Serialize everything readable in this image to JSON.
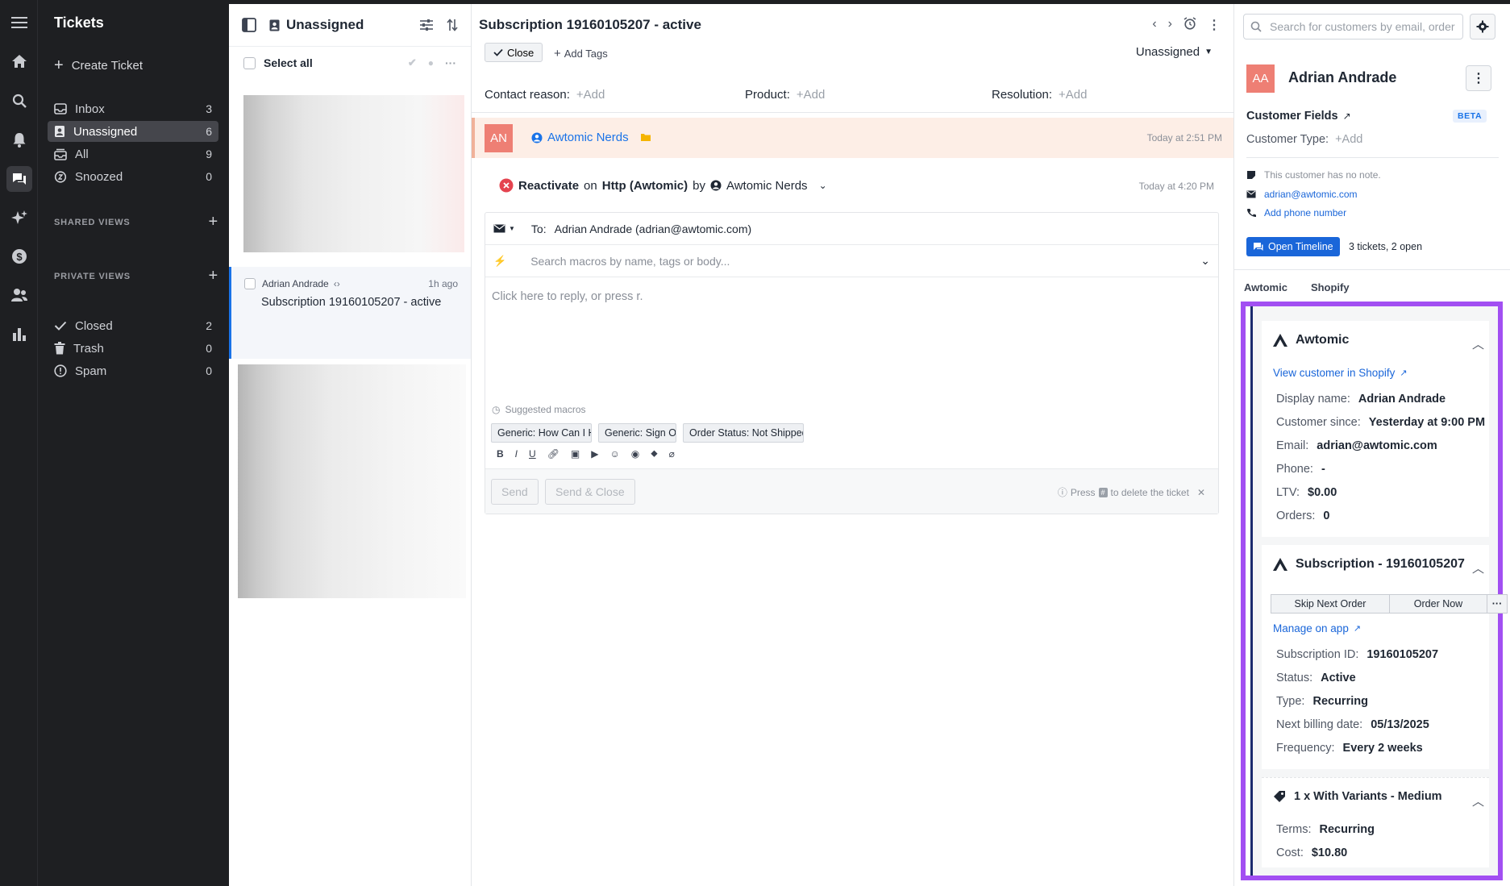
{
  "nav": {
    "title": "Tickets",
    "create": "Create Ticket",
    "items": [
      {
        "label": "Inbox",
        "count": "3"
      },
      {
        "label": "Unassigned",
        "count": "6"
      },
      {
        "label": "All",
        "count": "9"
      },
      {
        "label": "Snoozed",
        "count": "0"
      }
    ],
    "shared_views": "SHARED VIEWS",
    "private_views": "PRIVATE VIEWS",
    "bottom_items": [
      {
        "label": "Closed",
        "count": "2"
      },
      {
        "label": "Trash",
        "count": "0"
      },
      {
        "label": "Spam",
        "count": "0"
      }
    ]
  },
  "list": {
    "title": "Unassigned",
    "select_all": "Select all",
    "ticket": {
      "customer": "Adrian Andrade",
      "ago": "1h ago",
      "subject": "Subscription 19160105207 - active"
    }
  },
  "ticket": {
    "title": "Subscription 19160105207 - active",
    "close": "Close",
    "add_tags": "Add Tags",
    "assignee": "Unassigned",
    "fields": [
      {
        "label": "Contact reason:",
        "value": "+Add"
      },
      {
        "label": "Product:",
        "value": "+Add"
      },
      {
        "label": "Resolution:",
        "value": "+Add"
      }
    ],
    "message": {
      "initials": "AN",
      "sender": "Awtomic Nerds",
      "time": "Today at 2:51 PM"
    },
    "event": {
      "action": "Reactivate",
      "on": "on",
      "integration": "Http (Awtomic)",
      "by": "by",
      "user": "Awtomic Nerds",
      "time": "Today at 4:20 PM"
    },
    "composer": {
      "to_label": "To:",
      "to_value": "Adrian Andrade (adrian@awtomic.com)",
      "macro_placeholder": "Search macros by name, tags or body...",
      "body_placeholder": "Click here to reply, or press r.",
      "suggested": "Suggested macros",
      "chips": [
        "Generic: How Can I Help",
        "Generic: Sign Off",
        "Order Status: Not Shipped"
      ],
      "send": "Send",
      "send_close": "Send & Close",
      "press": "Press",
      "press_key": "#",
      "press_rest": "to delete the ticket"
    }
  },
  "customer": {
    "search_placeholder": "Search for customers by email, order",
    "initials": "AA",
    "name": "Adrian Andrade",
    "fields_title": "Customer Fields",
    "beta": "BETA",
    "type_label": "Customer Type:",
    "type_add": "+Add",
    "note": "This customer has no note.",
    "email": "adrian@awtomic.com",
    "phone": "Add phone number",
    "timeline_btn": "Open Timeline",
    "tickets": "3 tickets, 2 open",
    "tabs": [
      "Awtomic",
      "Shopify"
    ],
    "awtomic": {
      "title": "Awtomic",
      "link": "View customer in Shopify",
      "rows": [
        {
          "k": "Display name:",
          "v": "Adrian Andrade"
        },
        {
          "k": "Customer since:",
          "v": "Yesterday at 9:00 PM"
        },
        {
          "k": "Email:",
          "v": "adrian@awtomic.com"
        },
        {
          "k": "Phone:",
          "v": "-"
        },
        {
          "k": "LTV:",
          "v": "$0.00"
        },
        {
          "k": "Orders:",
          "v": "0"
        }
      ]
    },
    "subscription": {
      "title": "Subscription - 19160105207",
      "skip": "Skip Next Order",
      "order_now": "Order Now",
      "more": "···",
      "link": "Manage on app",
      "rows": [
        {
          "k": "Subscription ID:",
          "v": "19160105207"
        },
        {
          "k": "Status:",
          "v": "Active"
        },
        {
          "k": "Type:",
          "v": "Recurring"
        },
        {
          "k": "Next billing date:",
          "v": "05/13/2025"
        },
        {
          "k": "Frequency:",
          "v": "Every 2 weeks"
        }
      ]
    },
    "product": {
      "title": "1 x With Variants - Medium",
      "rows": [
        {
          "k": "Terms:",
          "v": "Recurring"
        },
        {
          "k": "Cost:",
          "v": "$10.80"
        }
      ]
    }
  },
  "colors": {
    "accent": "#1a66d9",
    "highlight": "#a24ff2",
    "avatar": "#ee7f74"
  }
}
